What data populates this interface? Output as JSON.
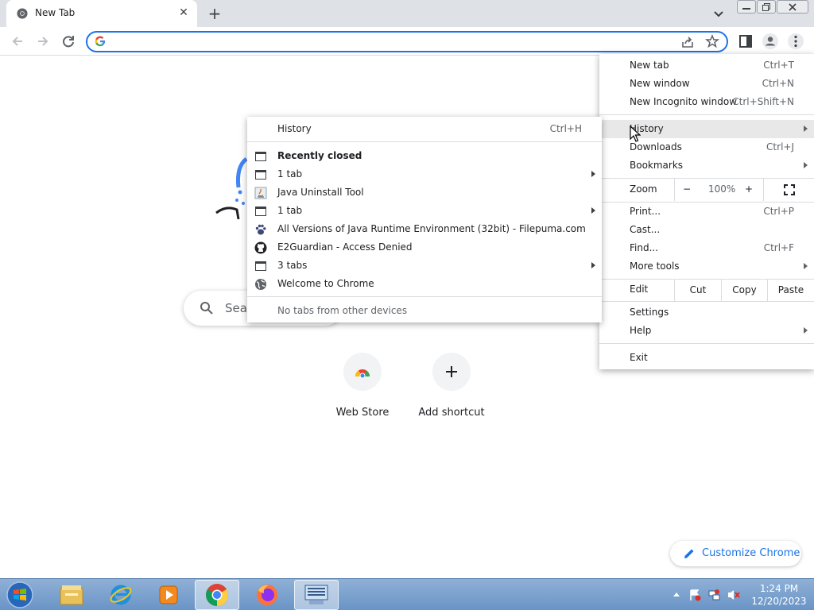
{
  "tab": {
    "title": "New Tab",
    "close_icon": "close-icon",
    "new_tab_icon": "plus-icon"
  },
  "omnibox": {
    "value": "",
    "placeholder": ""
  },
  "new_tab_page": {
    "search_placeholder": "Sea",
    "shortcuts": [
      {
        "label": "Web Store",
        "icon": "webstore-icon"
      },
      {
        "label": "Add shortcut",
        "icon": "plus-icon"
      }
    ],
    "customize_label": "Customize Chrome"
  },
  "menu": {
    "new_tab": {
      "label": "New tab",
      "shortcut": "Ctrl+T"
    },
    "new_window": {
      "label": "New window",
      "shortcut": "Ctrl+N"
    },
    "new_incognito": {
      "label": "New Incognito window",
      "shortcut": "Ctrl+Shift+N"
    },
    "history": {
      "label": "History"
    },
    "downloads": {
      "label": "Downloads",
      "shortcut": "Ctrl+J"
    },
    "bookmarks": {
      "label": "Bookmarks"
    },
    "zoom": {
      "label": "Zoom",
      "minus": "−",
      "value": "100%",
      "plus": "+"
    },
    "print": {
      "label": "Print...",
      "shortcut": "Ctrl+P"
    },
    "cast": {
      "label": "Cast..."
    },
    "find": {
      "label": "Find...",
      "shortcut": "Ctrl+F"
    },
    "more_tools": {
      "label": "More tools"
    },
    "edit": {
      "label": "Edit",
      "cut": "Cut",
      "copy": "Copy",
      "paste": "Paste"
    },
    "settings": {
      "label": "Settings"
    },
    "help": {
      "label": "Help"
    },
    "exit": {
      "label": "Exit"
    }
  },
  "history_submenu": {
    "history": {
      "label": "History",
      "shortcut": "Ctrl+H"
    },
    "recently_closed": "Recently closed",
    "items": [
      {
        "label": "1 tab",
        "icon": "window-icon",
        "has_submenu": true
      },
      {
        "label": "Java Uninstall Tool",
        "icon": "java-icon",
        "has_submenu": false
      },
      {
        "label": "1 tab",
        "icon": "window-icon",
        "has_submenu": true
      },
      {
        "label": "All Versions of Java Runtime Environment (32bit) - Filepuma.com",
        "icon": "paw-icon",
        "has_submenu": false
      },
      {
        "label": "E2Guardian - Access Denied",
        "icon": "github-icon",
        "has_submenu": false
      },
      {
        "label": "3 tabs",
        "icon": "window-icon",
        "has_submenu": true
      },
      {
        "label": "Welcome to Chrome",
        "icon": "globe-icon",
        "has_submenu": false
      }
    ],
    "no_other_devices": "No tabs from other devices"
  },
  "taskbar": {
    "apps": [
      "file-explorer-icon",
      "internet-explorer-icon",
      "media-player-icon",
      "chrome-icon",
      "firefox-icon",
      "screen-keyboard-icon"
    ],
    "time": "1:24 PM",
    "date": "12/20/2023"
  },
  "colors": {
    "accent": "#1a73e8",
    "tabstrip": "#dee1e6",
    "menu_highlight": "#e8e8e8"
  }
}
